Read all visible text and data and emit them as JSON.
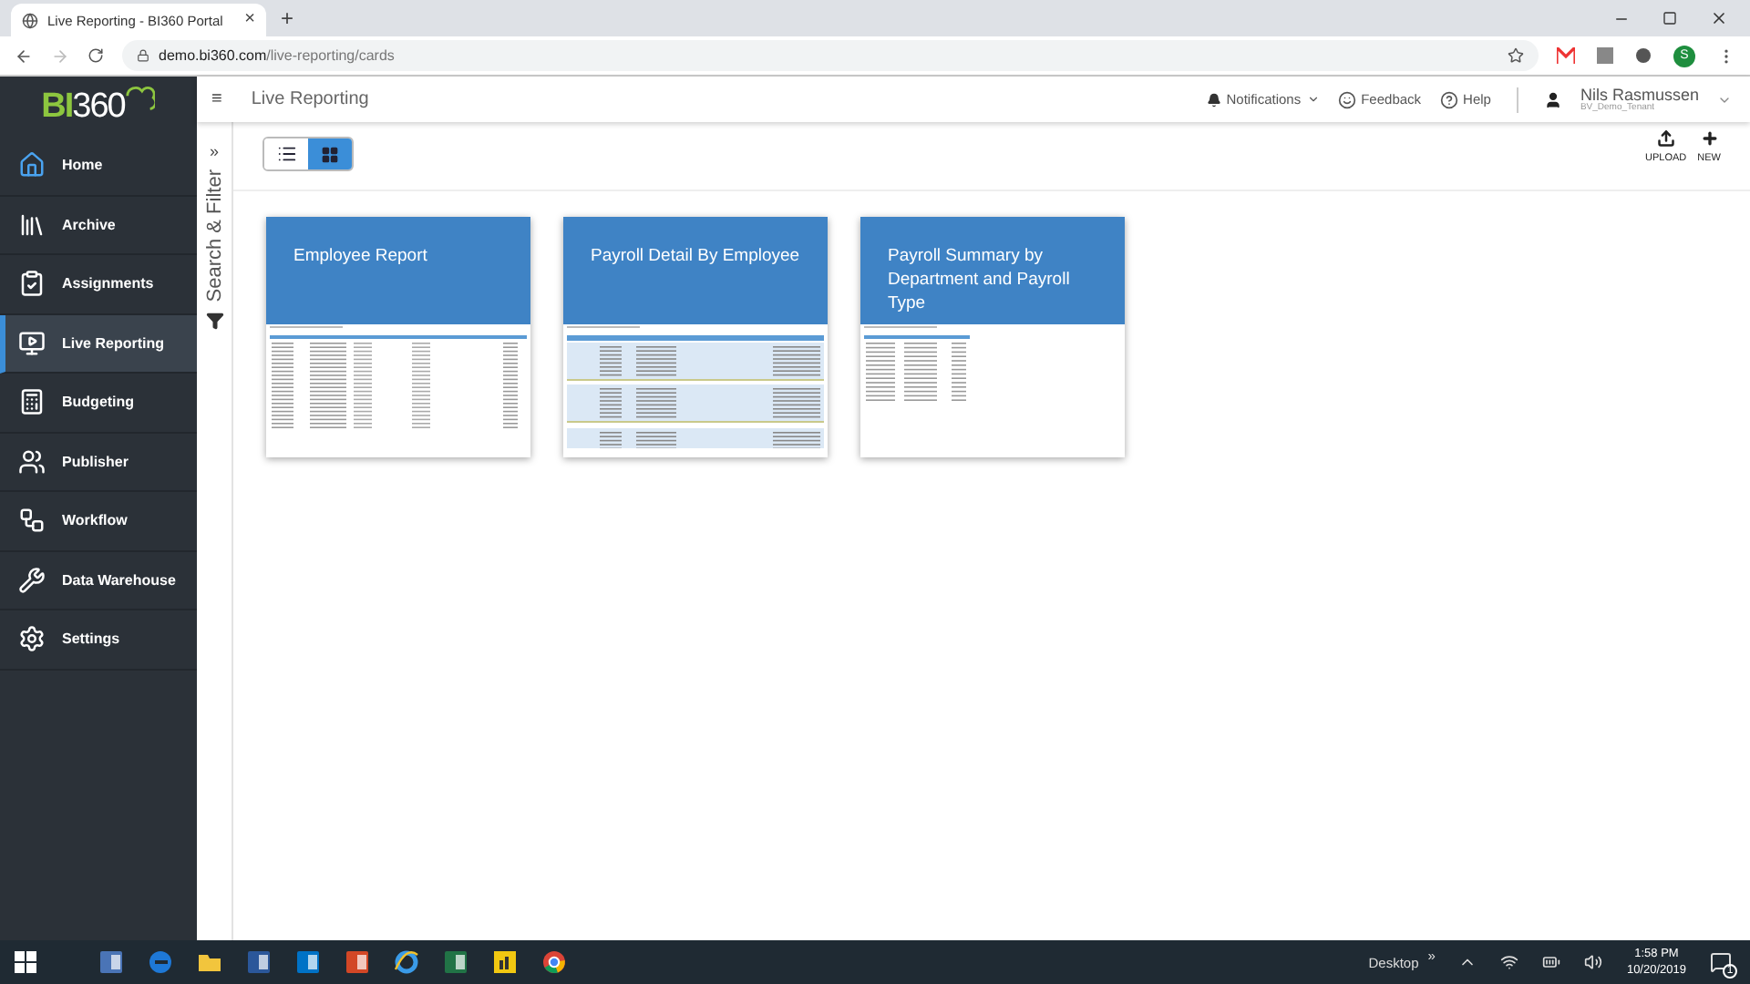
{
  "browser": {
    "tab": {
      "title": "Live Reporting - BI360 Portal",
      "close": "×"
    },
    "new_tab": "+",
    "url": {
      "host": "demo.bi360.com",
      "path": "/live-reporting/cards"
    },
    "profile_initial": "S"
  },
  "logo": {
    "prefix": "BI",
    "suffix": "360"
  },
  "sidebar": {
    "items": [
      {
        "label": "Home",
        "selected": false
      },
      {
        "label": "Archive",
        "selected": false
      },
      {
        "label": "Assignments",
        "selected": false
      },
      {
        "label": "Live Reporting",
        "selected": true
      },
      {
        "label": "Budgeting",
        "selected": false
      },
      {
        "label": "Publisher",
        "selected": false
      },
      {
        "label": "Workflow",
        "selected": false
      },
      {
        "label": "Data Warehouse",
        "selected": false
      },
      {
        "label": "Settings",
        "selected": false
      }
    ]
  },
  "header": {
    "menu": "≡",
    "title": "Live Reporting",
    "notifications": "Notifications",
    "feedback": "Feedback",
    "help": "Help",
    "user": {
      "name": "Nils Rasmussen",
      "tenant": "BV_Demo_Tenant"
    }
  },
  "filter_panel": {
    "expand": "»",
    "label": "Search & Filter"
  },
  "view_toggle": [
    {
      "kind": "list",
      "selected": false
    },
    {
      "kind": "grid",
      "selected": true
    }
  ],
  "actions": [
    {
      "kind": "upload",
      "label": "UPLOAD"
    },
    {
      "kind": "new",
      "label": "NEW"
    }
  ],
  "cards": [
    {
      "title": "Employee Report",
      "kind": "list"
    },
    {
      "title": "Payroll Detail By Employee",
      "kind": "grouped"
    },
    {
      "title": "Payroll Summary by Department and Payroll Type",
      "kind": "summary"
    }
  ],
  "taskbar": {
    "desktop": "Desktop",
    "more": "»",
    "time": "1:58 PM",
    "date": "10/20/2019",
    "notification_count": "1"
  }
}
